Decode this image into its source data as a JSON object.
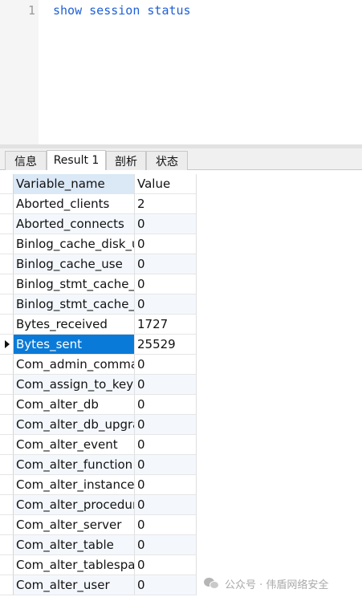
{
  "editor": {
    "line_numbers": [
      "1"
    ],
    "code": "show session status"
  },
  "tabs": [
    {
      "label": "信息",
      "active": false
    },
    {
      "label": "Result 1",
      "active": true
    },
    {
      "label": "剖析",
      "active": false
    },
    {
      "label": "状态",
      "active": false
    }
  ],
  "grid": {
    "columns": [
      "Variable_name",
      "Value"
    ],
    "selected_row": 7,
    "rows": [
      [
        "Aborted_clients",
        "2"
      ],
      [
        "Aborted_connects",
        "0"
      ],
      [
        "Binlog_cache_disk_use",
        "0"
      ],
      [
        "Binlog_cache_use",
        "0"
      ],
      [
        "Binlog_stmt_cache_disk_use",
        "0"
      ],
      [
        "Binlog_stmt_cache_use",
        "0"
      ],
      [
        "Bytes_received",
        "1727"
      ],
      [
        "Bytes_sent",
        "25529"
      ],
      [
        "Com_admin_commands",
        "0"
      ],
      [
        "Com_assign_to_keycache",
        "0"
      ],
      [
        "Com_alter_db",
        "0"
      ],
      [
        "Com_alter_db_upgrade",
        "0"
      ],
      [
        "Com_alter_event",
        "0"
      ],
      [
        "Com_alter_function",
        "0"
      ],
      [
        "Com_alter_instance",
        "0"
      ],
      [
        "Com_alter_procedure",
        "0"
      ],
      [
        "Com_alter_server",
        "0"
      ],
      [
        "Com_alter_table",
        "0"
      ],
      [
        "Com_alter_tablespace",
        "0"
      ],
      [
        "Com_alter_user",
        "0"
      ]
    ]
  },
  "watermark": {
    "text": "公众号 · 伟盾网络安全",
    "icon": "wechat-icon"
  }
}
